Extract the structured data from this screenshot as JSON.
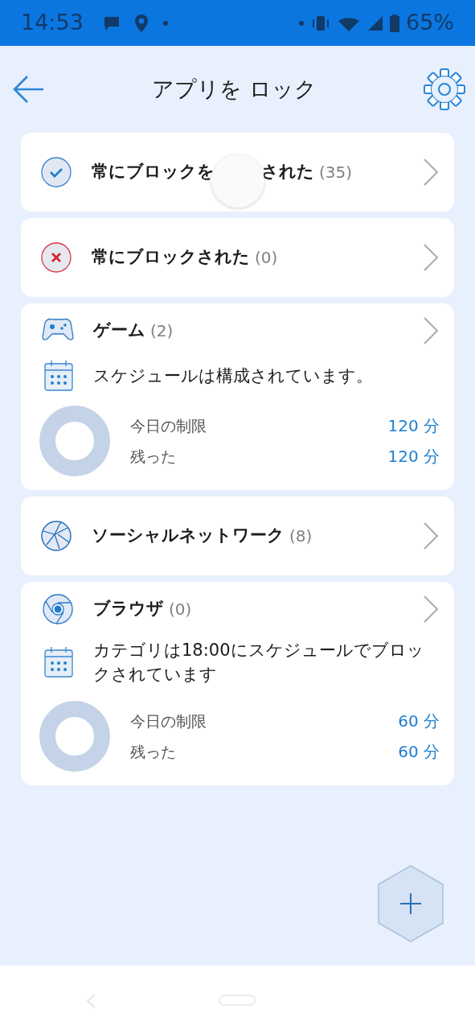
{
  "status_bar": {
    "time": "14:53",
    "battery": "65%"
  },
  "header": {
    "title": "アプリを ロック"
  },
  "cards": [
    {
      "kind": "simple",
      "title_start": "常にブロックを",
      "title_end": "された",
      "count": "(35)",
      "touch_indicator": true
    },
    {
      "kind": "simple",
      "title": "常にブロックされた",
      "count": "(0)"
    },
    {
      "kind": "scheduled",
      "title": "ゲーム",
      "count": "(2)",
      "schedule": "スケジュールは構成されています。",
      "limit_label": "今日の制限",
      "limit_value": "120 分",
      "left_label": "残った",
      "left_value": "120 分"
    },
    {
      "kind": "simple",
      "title": "ソーシャルネットワーク",
      "count": "(8)"
    },
    {
      "kind": "scheduled",
      "title": "ブラウザ",
      "count": "(0)",
      "schedule": "カテゴリは18:00にスケジュールでブロックされています",
      "limit_label": "今日の制限",
      "limit_value": "60 分",
      "left_label": "残った",
      "left_value": "60 分"
    }
  ]
}
